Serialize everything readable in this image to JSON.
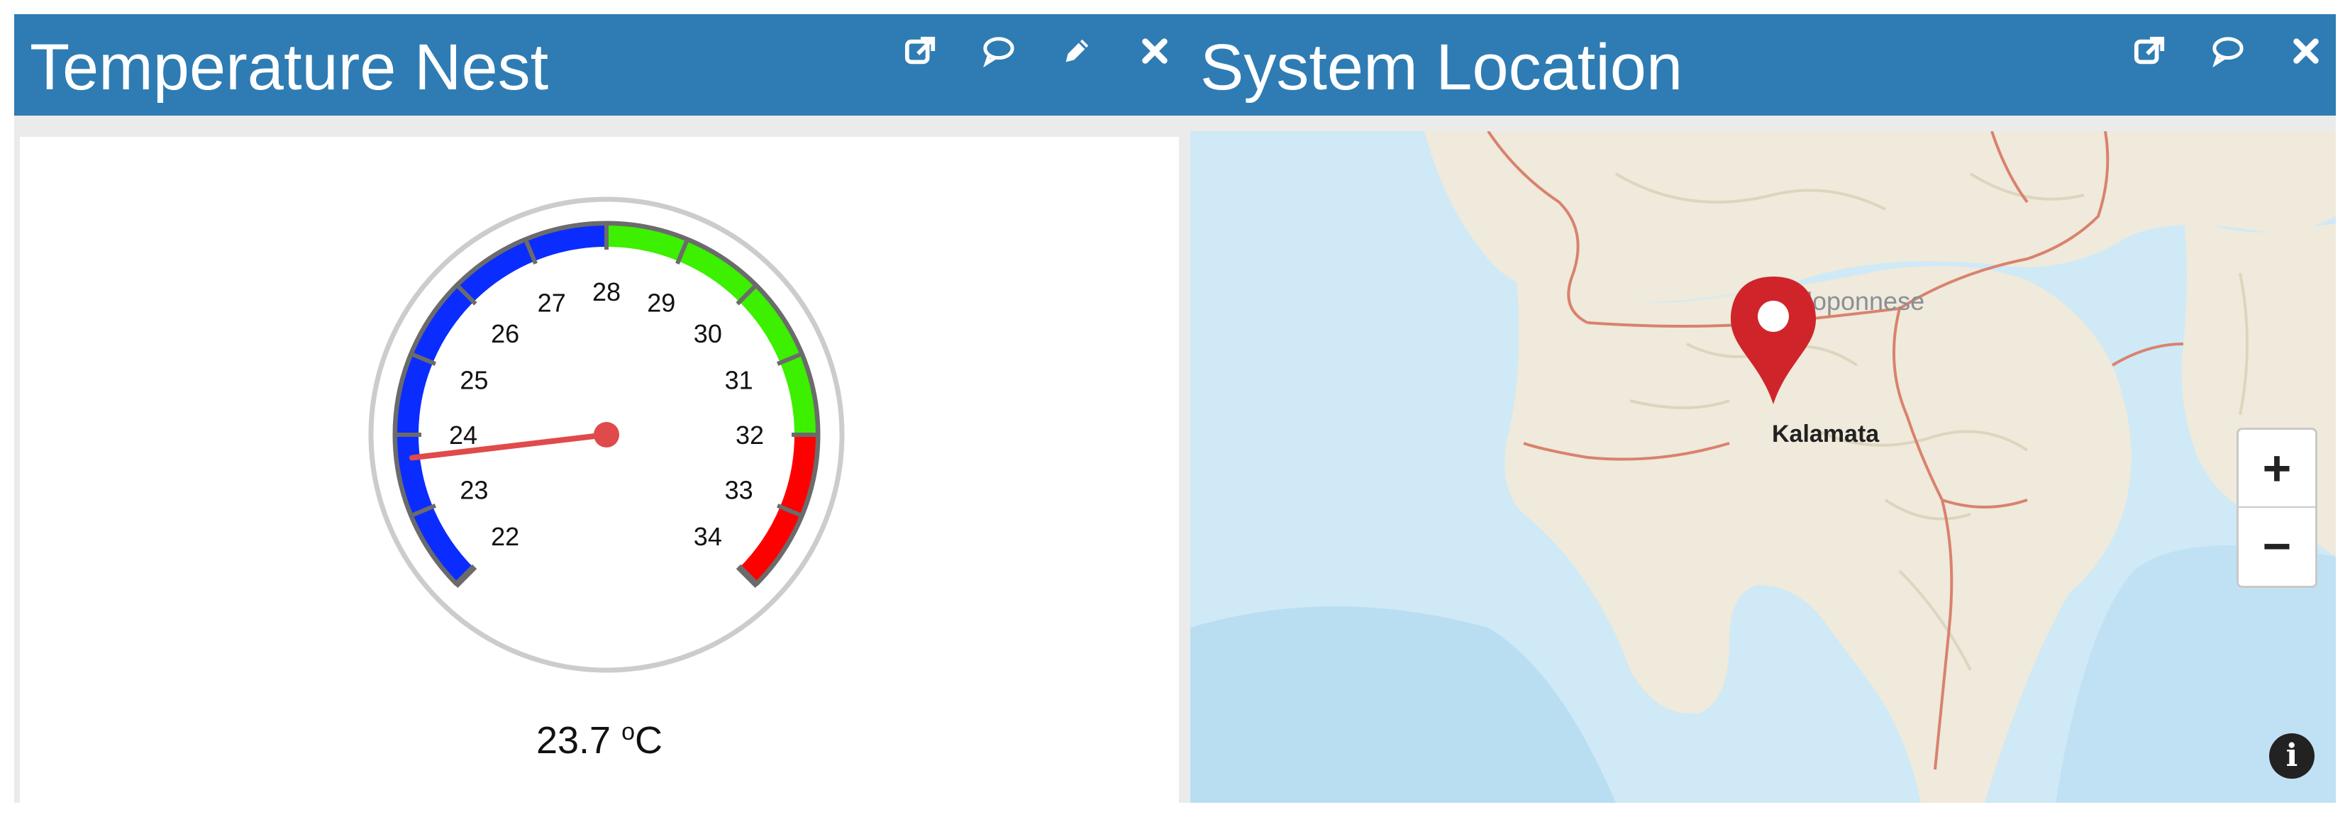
{
  "temperature_widget": {
    "title": "Temperature Nest",
    "tools": [
      {
        "icon": "external-link-icon",
        "label": "Open in new window"
      },
      {
        "icon": "comment-icon",
        "label": "Comment"
      },
      {
        "icon": "pencil-icon",
        "label": "Edit"
      },
      {
        "icon": "close-icon",
        "label": "Close"
      }
    ],
    "gauge": {
      "min": 22,
      "max": 34,
      "value": 23.7,
      "unit": "°C",
      "value_text": "23.7",
      "unit_superscript": "o",
      "unit_letter": "C",
      "ticks": [
        "22",
        "23",
        "24",
        "25",
        "26",
        "27",
        "28",
        "29",
        "30",
        "31",
        "32",
        "33",
        "34"
      ],
      "bands": [
        {
          "from": 22,
          "to": 28,
          "color": "#0b2cff"
        },
        {
          "from": 28,
          "to": 32,
          "color": "#3cf000"
        },
        {
          "from": 32,
          "to": 34,
          "color": "#ff0000"
        }
      ],
      "needle_color": "#e04a4a",
      "rim_color": "#cccccc"
    }
  },
  "location_widget": {
    "title": "System Location",
    "tools": [
      {
        "icon": "external-link-icon",
        "label": "Open in new window"
      },
      {
        "icon": "comment-icon",
        "label": "Comment"
      },
      {
        "icon": "close-icon",
        "label": "Close"
      }
    ],
    "map": {
      "region_label": "Peloponnese",
      "marker_label": "Kalamata",
      "zoom_in_label": "+",
      "zoom_out_label": "−",
      "info_label": "i",
      "sea_color": "#cfe9f6",
      "land_color": "#efeadb",
      "border_color": "#d9826e",
      "marker_color": "#d0242b"
    }
  }
}
